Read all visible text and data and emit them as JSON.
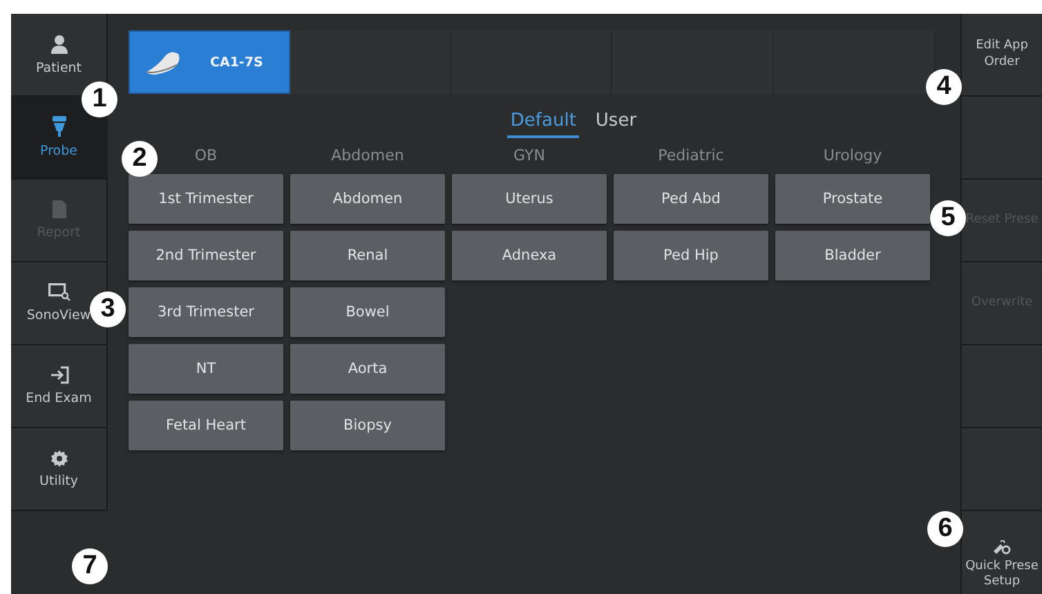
{
  "sidebar": {
    "items": [
      {
        "label": "Patient",
        "kind": "patient",
        "selected": false,
        "disabled": false
      },
      {
        "label": "Probe",
        "kind": "probe",
        "selected": true,
        "disabled": false
      },
      {
        "label": "Report",
        "kind": "report",
        "selected": false,
        "disabled": true
      },
      {
        "label": "SonoView",
        "kind": "sonoview",
        "selected": false,
        "disabled": false
      },
      {
        "label": "End Exam",
        "kind": "end_exam",
        "selected": false,
        "disabled": false
      },
      {
        "label": "Utility",
        "kind": "utility",
        "selected": false,
        "disabled": false
      }
    ]
  },
  "probes": [
    {
      "label": "CA1-7S",
      "selected": true
    },
    {
      "selected": false
    },
    {
      "selected": false
    },
    {
      "selected": false
    },
    {
      "selected": false
    }
  ],
  "preset_tabs": [
    {
      "label": "Default",
      "selected": true
    },
    {
      "label": "User",
      "selected": false
    }
  ],
  "columns": [
    {
      "title": "OB",
      "presets": [
        "1st Trimester",
        "2nd Trimester",
        "3rd Trimester",
        "NT",
        "Fetal Heart"
      ]
    },
    {
      "title": "Abdomen",
      "presets": [
        "Abdomen",
        "Renal",
        "Bowel",
        "Aorta",
        "Biopsy"
      ]
    },
    {
      "title": "GYN",
      "presets": [
        "Uterus",
        "Adnexa"
      ]
    },
    {
      "title": "Pediatric",
      "presets": [
        "Ped Abd",
        "Ped Hip"
      ]
    },
    {
      "title": "Urology",
      "presets": [
        "Prostate",
        "Bladder"
      ]
    }
  ],
  "right_panel": {
    "buttons": [
      {
        "kind": "text",
        "lines": [
          "Edit App",
          "Order"
        ],
        "disabled": false
      },
      {
        "kind": "empty"
      },
      {
        "kind": "text",
        "lines": [
          "Reset Prese"
        ],
        "disabled": true
      },
      {
        "kind": "text",
        "lines": [
          "Overwrite"
        ],
        "disabled": true
      },
      {
        "kind": "empty"
      },
      {
        "kind": "empty"
      },
      {
        "kind": "quick",
        "lines": [
          "Quick Prese",
          "Setup"
        ],
        "disabled": false
      }
    ]
  },
  "callouts": [
    "1",
    "2",
    "3",
    "4",
    "5",
    "6",
    "7"
  ]
}
